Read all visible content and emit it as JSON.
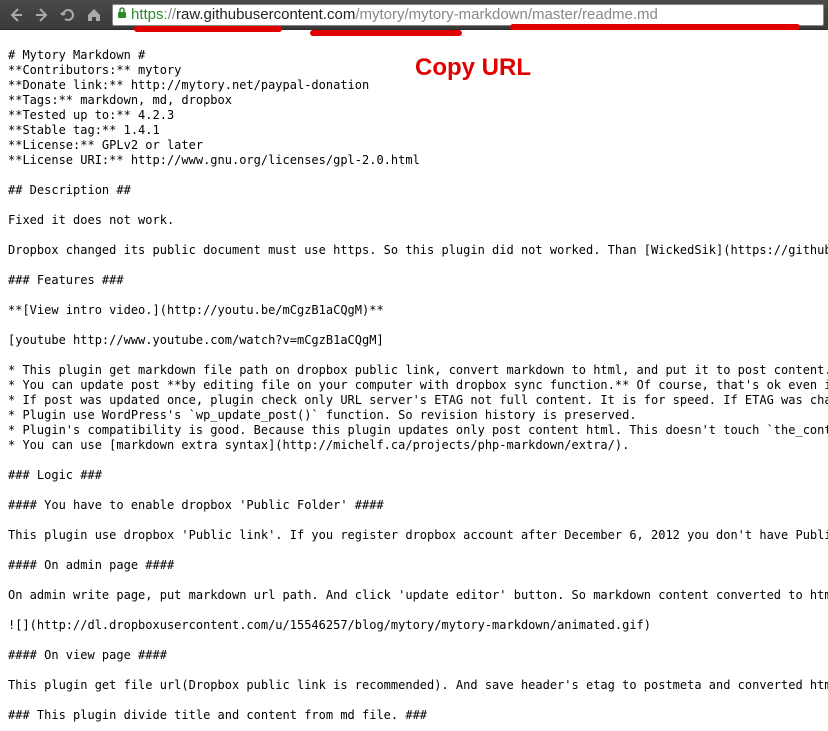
{
  "toolbar": {
    "back_label": "Back",
    "forward_label": "Forward",
    "reload_label": "Reload",
    "home_label": "Home"
  },
  "url": {
    "scheme": "https",
    "sep": "://",
    "host": "raw.githubusercontent.com",
    "path_light": "/mytory/mytory-markdown/master/readme.md"
  },
  "annotation": {
    "copy_url": "Copy URL"
  },
  "readme": {
    "h1": "# Mytory Markdown #",
    "contributors": "**Contributors:** mytory",
    "donate": "**Donate link:** http://mytory.net/paypal-donation",
    "tags": "**Tags:** markdown, md, dropbox",
    "tested": "**Tested up to:** 4.2.3",
    "stable": "**Stable tag:** 1.4.1",
    "license": "**License:** GPLv2 or later",
    "license_uri": "**License URI:** http://www.gnu.org/licenses/gpl-2.0.html",
    "h2_desc": "## Description ##",
    "desc_p1": "Fixed it does not work.",
    "desc_p2": "Dropbox changed its public document must use https. So this plugin did not worked. Than [WickedSik](https://github.com/WickedSi",
    "h3_features": "### Features ###",
    "intro_video": "**[View intro video.](http://youtu.be/mCgzB1aCQgM)**",
    "youtube": "[youtube http://www.youtube.com/watch?v=mCgzB1aCQgM]",
    "f1": "* This plugin get markdown file path on dropbox public link, convert markdown to html, and put it to post content.",
    "f2": "* You can update post **by editing file on your computer with dropbox sync function.** Of course, that's ok even if content edi",
    "f3": "* If post was updated once, plugin check only URL server's ETAG not full content. It is for speed. If ETAG was changed, plugin ",
    "f4": "* Plugin use WordPress's `wp_update_post()` function. So revision history is preserved.",
    "f5": "* Plugin's compatibility is good. Because this plugin updates only post content html. This doesn't touch `the_content` process(",
    "f6": "* You can use [markdown extra syntax](http://michelf.ca/projects/php-markdown/extra/).",
    "h3_logic": "### Logic ###",
    "h4_enable": "#### You have to enable dropbox 'Public Folder' ####",
    "logic_p1": "This plugin use dropbox 'Public link'. If you register dropbox account after December 6, 2012 you don't have Public folder. The",
    "h4_admin": "#### On admin page ####",
    "admin_p1": "On admin write page, put markdown url path. And click 'update editor' button. So markdown content converted to html is putted t",
    "anim_gif": "![](http://dl.dropboxusercontent.com/u/15546257/blog/mytory/mytory-markdown/animated.gif)",
    "h4_view": "#### On view page ####",
    "view_p1": "This plugin get file url(Dropbox public link is recommended). And save header's etag to postmeta and converted html to post_con",
    "h3_divide": "### This plugin divide title and content from md file. ###"
  }
}
